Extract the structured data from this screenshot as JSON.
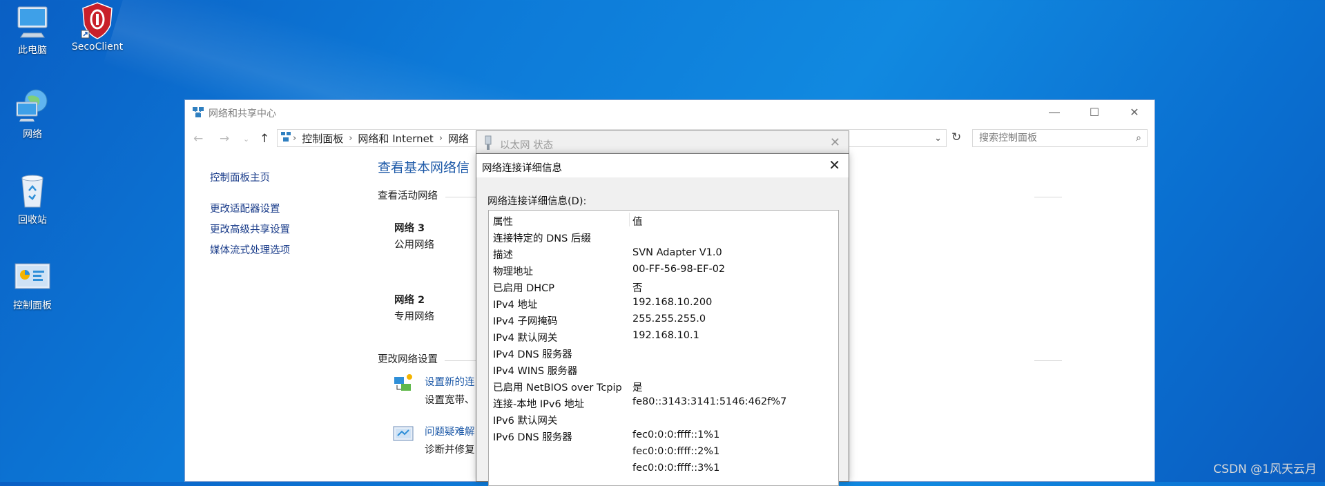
{
  "desktop": {
    "icons": [
      {
        "label": "此电脑",
        "icon": "computer-icon"
      },
      {
        "label": "SecoClient",
        "icon": "secoclient-shield-icon"
      },
      {
        "label": "网络",
        "icon": "network-globe-icon"
      },
      {
        "label": "回收站",
        "icon": "recycle-bin-icon"
      },
      {
        "label": "控制面板",
        "icon": "control-panel-icon"
      }
    ]
  },
  "window": {
    "title": "网络和共享中心",
    "address": {
      "crumbs": [
        "控制面板",
        "网络和 Internet",
        "网络"
      ]
    },
    "search_placeholder": "搜索控制面板",
    "left_links": [
      "控制面板主页",
      "更改适配器设置",
      "更改高级共享设置",
      "媒体流式处理选项"
    ],
    "main_title": "查看基本网络信",
    "active_networks_heading": "查看活动网络",
    "networks": [
      {
        "name": "网络 3",
        "type": "公用网络"
      },
      {
        "name": "网络 2",
        "type": "专用网络"
      }
    ],
    "change_settings_heading": "更改网络设置",
    "tasks": [
      {
        "link": "设置新的连",
        "desc": "设置宽带、",
        "icon": "new-connection-icon"
      },
      {
        "link": "问题疑难解",
        "desc": "诊断并修复",
        "icon": "troubleshoot-icon"
      }
    ]
  },
  "status_dialog": {
    "title": "以太网 状态"
  },
  "details_dialog": {
    "title": "网络连接详细信息",
    "label": "网络连接详细信息(D):",
    "columns": [
      "属性",
      "值"
    ],
    "rows": [
      {
        "k": "连接特定的 DNS 后缀",
        "v": ""
      },
      {
        "k": "描述",
        "v": "SVN Adapter V1.0"
      },
      {
        "k": "物理地址",
        "v": "00-FF-56-98-EF-02"
      },
      {
        "k": "已启用 DHCP",
        "v": "否"
      },
      {
        "k": "IPv4 地址",
        "v": "192.168.10.200"
      },
      {
        "k": "IPv4 子网掩码",
        "v": "255.255.255.0"
      },
      {
        "k": "IPv4 默认网关",
        "v": "192.168.10.1"
      },
      {
        "k": "IPv4 DNS 服务器",
        "v": ""
      },
      {
        "k": "IPv4 WINS 服务器",
        "v": ""
      },
      {
        "k": "已启用 NetBIOS over Tcpip",
        "v": "是"
      },
      {
        "k": "连接-本地 IPv6 地址",
        "v": "fe80::3143:3141:5146:462f%7"
      },
      {
        "k": "IPv6 默认网关",
        "v": ""
      },
      {
        "k": "IPv6 DNS 服务器",
        "v": "fec0:0:0:ffff::1%1"
      },
      {
        "k": "",
        "v": "fec0:0:0:ffff::2%1"
      },
      {
        "k": "",
        "v": "fec0:0:0:ffff::3%1"
      }
    ]
  },
  "watermark": "CSDN @1风天云月",
  "colors": {
    "link": "#1e5aa8",
    "desktop": "#0d7ad8"
  }
}
